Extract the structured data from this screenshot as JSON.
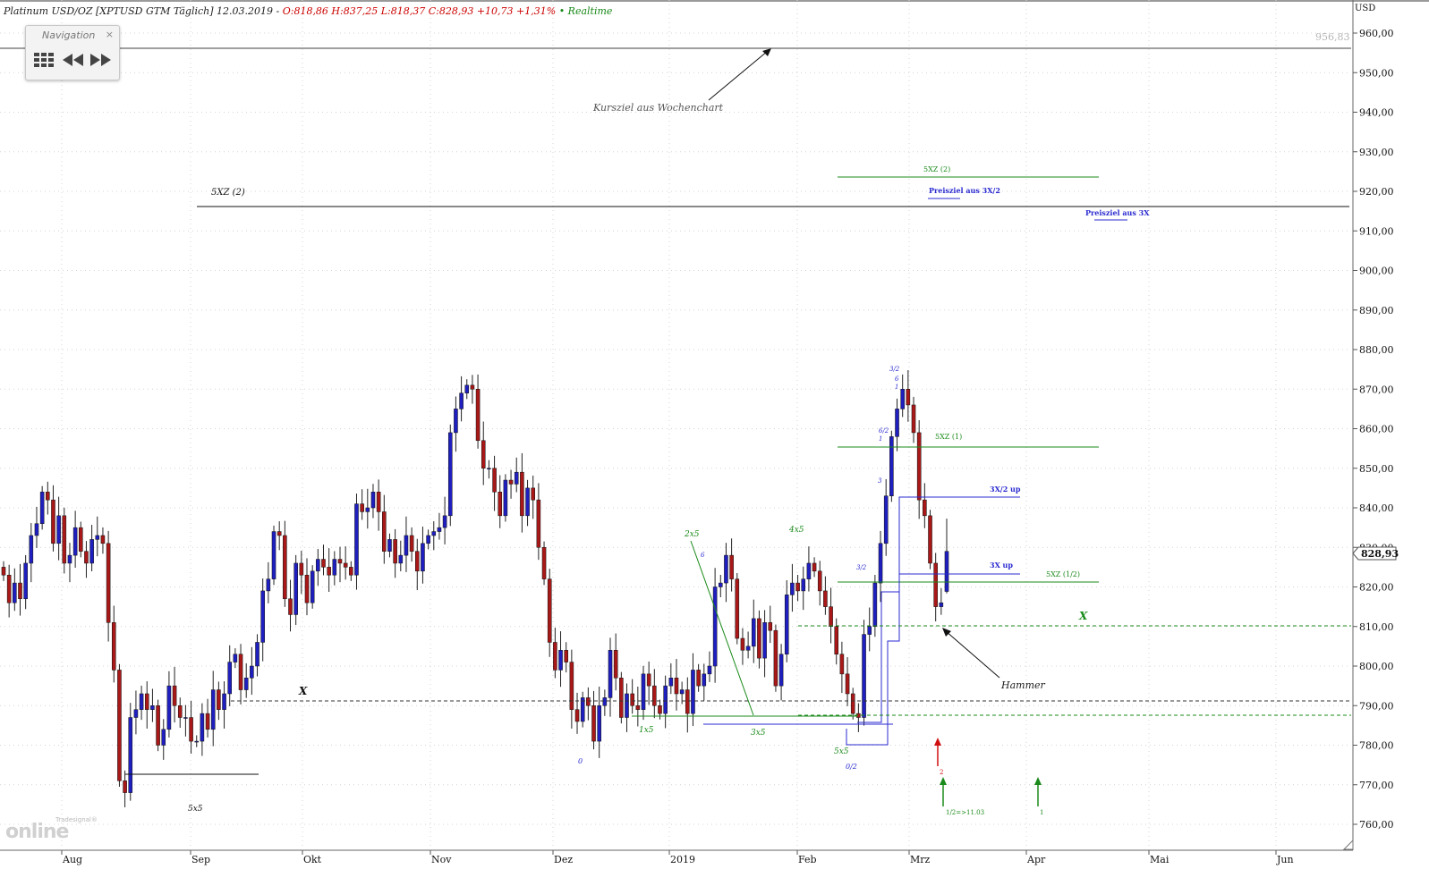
{
  "header": {
    "instrument": "Platinum USD/OZ [XPTUSD GTM Täglich] 12.03.2019 -",
    "ohlc": "O:818,86 H:837,25 L:818,37 C:828,93 +10,73 +1,31%",
    "status": "• Realtime"
  },
  "navigation": {
    "title": "Navigation",
    "close": "×"
  },
  "watermark": {
    "small": "Tradesignal®",
    "big": "online"
  },
  "colors": {
    "up_body": "#1f1fbf",
    "down_body": "#a81818",
    "green": "#1a8a1a",
    "blue": "#2a2ad0",
    "black": "#000000"
  },
  "chart_data": {
    "type": "candlestick",
    "currency": "USD",
    "ylim": [
      755.5,
      973
    ],
    "y_ticks": [
      "760,00",
      "770,00",
      "780,00",
      "790,00",
      "800,00",
      "810,00",
      "820,00",
      "830,00",
      "840,00",
      "850,00",
      "860,00",
      "870,00",
      "880,00",
      "890,00",
      "900,00",
      "910,00",
      "920,00",
      "930,00",
      "940,00",
      "950,00",
      "960,00"
    ],
    "x_labels": [
      "Aug",
      "Sep",
      "Okt",
      "Nov",
      "Dez",
      "2019",
      "Feb",
      "Mrz",
      "Apr",
      "Mai",
      "Jun"
    ],
    "last_price": "828,93",
    "marker_price": "956,83",
    "closes": [
      823,
      816,
      821,
      817,
      826,
      833,
      836,
      844,
      842,
      831,
      838,
      826,
      828,
      835,
      829,
      826,
      832,
      833,
      831,
      811,
      799,
      771,
      768,
      787,
      789,
      793,
      789,
      790,
      780,
      784,
      795,
      790,
      787,
      787,
      781,
      781,
      788,
      784,
      794,
      789,
      793,
      801,
      803,
      794,
      797,
      800,
      806,
      819,
      822,
      834,
      833,
      817,
      813,
      826,
      823,
      816,
      824,
      827,
      825,
      823,
      827,
      826,
      825,
      823,
      841,
      839,
      840,
      844,
      839,
      829,
      832,
      826,
      828,
      833,
      829,
      824,
      831,
      833,
      834,
      835,
      838,
      859,
      865,
      869,
      871,
      870,
      857,
      850,
      850,
      844,
      838,
      847,
      846,
      849,
      838,
      845,
      842,
      830,
      822,
      806,
      799,
      804,
      801,
      789,
      786,
      792,
      790,
      781,
      790,
      792,
      804,
      797,
      787,
      793,
      790,
      789,
      798,
      795,
      790,
      788,
      795,
      797,
      793,
      794,
      788,
      799,
      795,
      798,
      800,
      820,
      821,
      828,
      822,
      807,
      804,
      805,
      812,
      802,
      811,
      809,
      795,
      803,
      818,
      821,
      819,
      822,
      826,
      824,
      819,
      815,
      810,
      803,
      798,
      793,
      788,
      787,
      808,
      810,
      821,
      831,
      843,
      858,
      865,
      870,
      866,
      859,
      842,
      838,
      826,
      815,
      816,
      829
    ]
  },
  "annotations": {
    "kursziel": "Kursziel aus Wochenchart",
    "fivexz2_left": "5XZ (2)",
    "fivexz2_right": "5XZ (2)",
    "preisziel_3x2": "Preisziel aus 3X/2",
    "preisziel_3x": "Preisziel aus 3X",
    "fivexz1": "5XZ (1)",
    "threex2up": "3X/2 up",
    "threexup": "3X up",
    "fivexzhalf": "5XZ (1/2)",
    "x_left": "X",
    "x_right": "X",
    "hammer": "Hammer",
    "lbl_5x5_sep": "5x5",
    "lbl_1x5": "1x5",
    "lbl_2x5": "2x5",
    "lbl_3x5": "3x5",
    "lbl_4x5": "4x5",
    "lbl_5x5_feb": "5x5",
    "lbl_0": "0",
    "lbl_0_2": "0/2",
    "lbl_6_dec": "6",
    "lbl_3_2_low": "3/2",
    "lbl_3": "3",
    "lbl_1": "1",
    "lbl_6_2": "6/2",
    "lbl_1_b": "1",
    "lbl_6": "6",
    "lbl_3_2_top": "3/2",
    "arrow_red_label": "2",
    "arrow_green_label": "1/2=>11.03",
    "arrow_green2_label": "1"
  }
}
